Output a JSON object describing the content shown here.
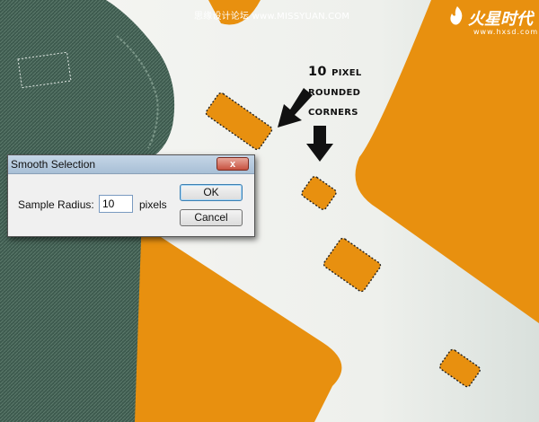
{
  "watermark": {
    "text": "思缘设计论坛 www.MISSYUAN.COM"
  },
  "logo": {
    "title": "火星时代",
    "url": "www.hxsd.com"
  },
  "annotation": {
    "lines": [
      "10 pixel",
      "rounded",
      "corners"
    ]
  },
  "dialog": {
    "title": "Smooth Selection",
    "close_label": "x",
    "field_label": "Sample Radius:",
    "field_value": "10",
    "unit": "pixels",
    "ok_label": "OK",
    "cancel_label": "Cancel"
  },
  "colors": {
    "orange": "#e8900f",
    "background": "#f2f2ef",
    "denim": "#3e5a4e"
  }
}
